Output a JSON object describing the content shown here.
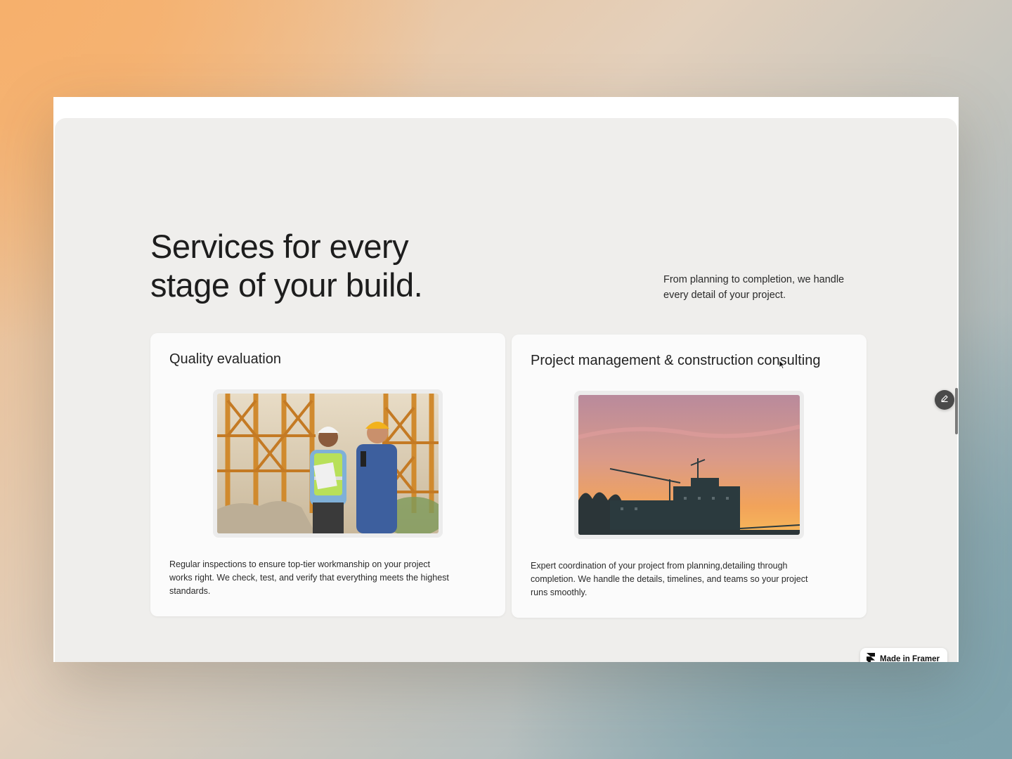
{
  "section": {
    "headline_line1": "Services for every",
    "headline_line2": "stage of your build.",
    "intro_line1": "From planning to completion, we handle",
    "intro_line2": "every detail of your project."
  },
  "cards": [
    {
      "title": "Quality evaluation",
      "image_icon": "construction-workers-photo",
      "text": "Regular inspections to ensure top-tier workmanship on your project works right. We check, test, and verify that everything meets the highest standards."
    },
    {
      "title": "Project management & construction consulting",
      "image_icon": "construction-site-sunset-photo",
      "text": "Expert coordination of your project from planning,detailing through completion. We handle the details, timelines, and teams so your project runs smoothly."
    }
  ],
  "badge": {
    "label": "Made in Framer",
    "icon": "framer-logo-icon"
  },
  "icons": {
    "edit": "pencil-icon",
    "cursor": "mouse-cursor-icon"
  },
  "colors": {
    "panel_bg": "#efeeec",
    "card_bg": "#fbfbfb",
    "text": "#1d1d1d"
  }
}
